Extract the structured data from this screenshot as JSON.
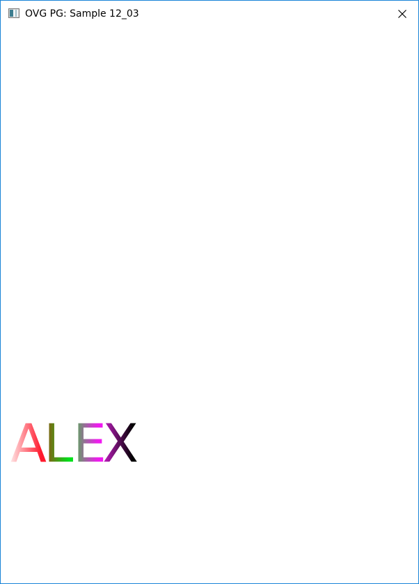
{
  "window": {
    "title": "OVG PG: Sample 12_03",
    "app_icon": "app-window-icon",
    "close_icon": "close-icon",
    "border_color": "#1883d7"
  },
  "canvas": {
    "text": "ALEX",
    "letters": [
      {
        "char": "A",
        "gradient": [
          "#ffe6e6",
          "#ff1a2e"
        ]
      },
      {
        "char": "L",
        "gradient": [
          "#9b4a12",
          "#00e01a"
        ]
      },
      {
        "char": "E",
        "gradient": [
          "#48b84a",
          "#f01af0"
        ]
      },
      {
        "char": "X",
        "gradient": [
          "#c81ec8",
          "#000000"
        ]
      }
    ]
  }
}
